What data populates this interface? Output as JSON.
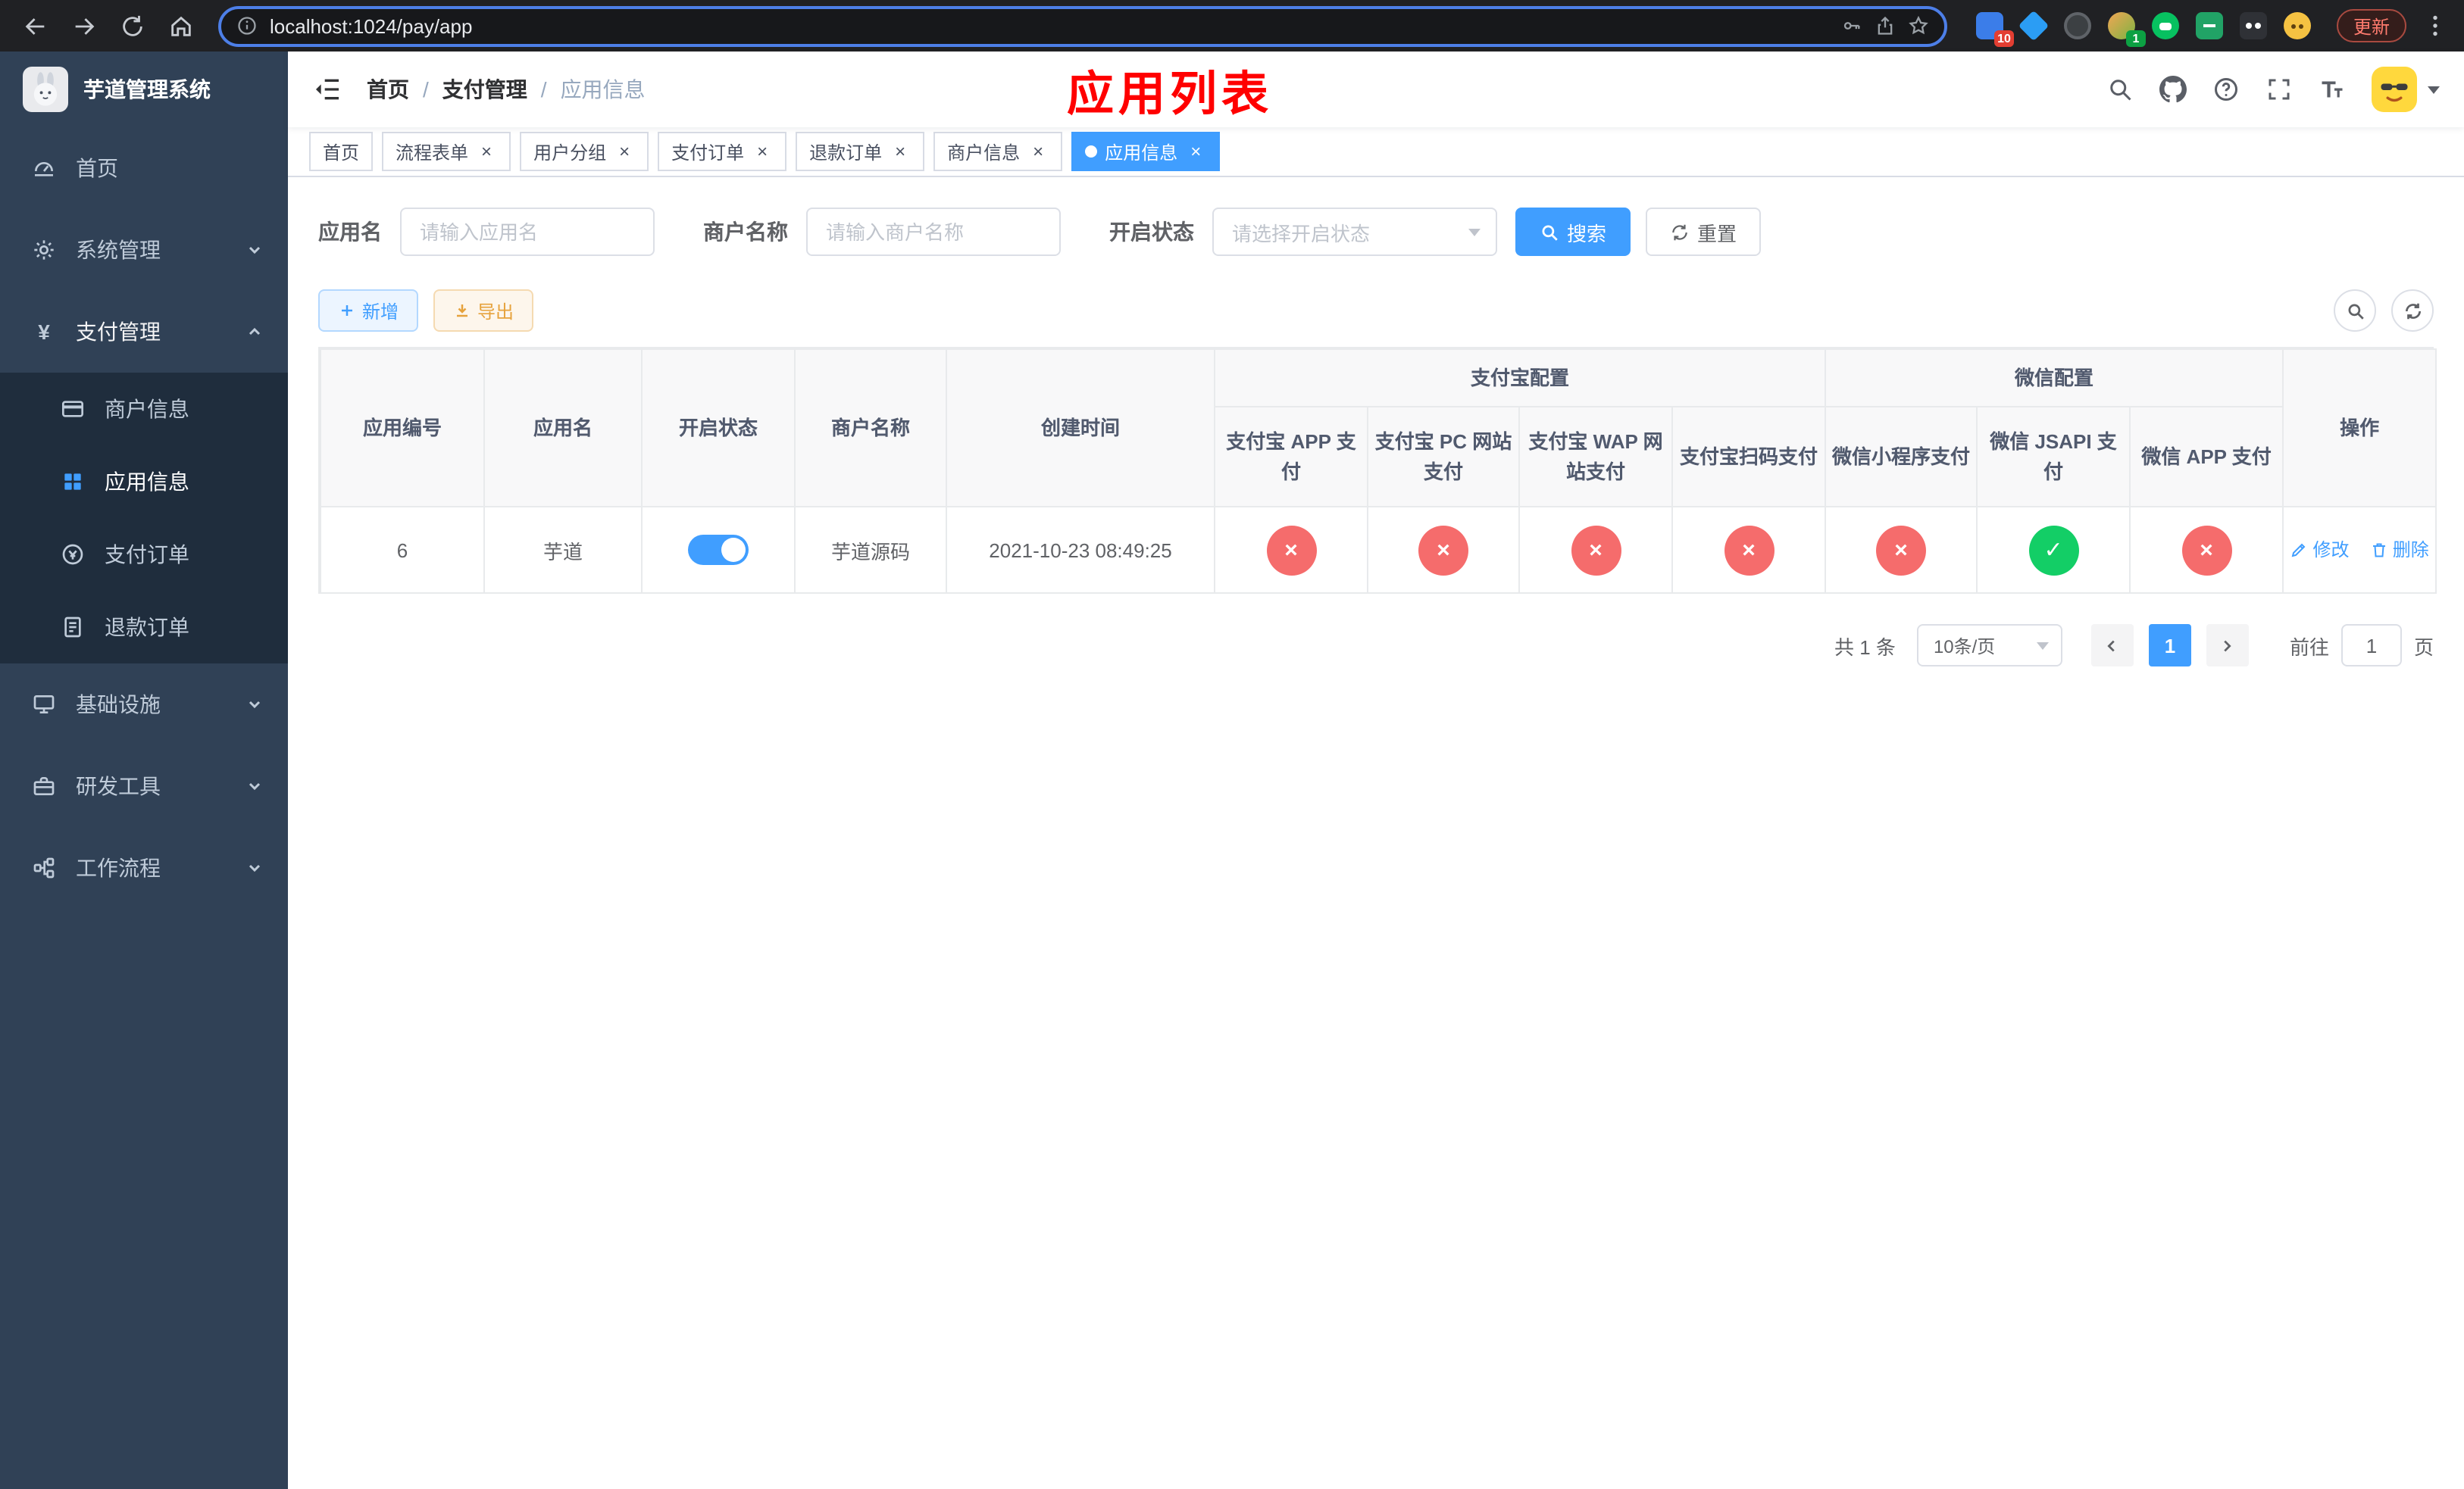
{
  "browser": {
    "url": "localhost:1024/pay/app",
    "update_label": "更新",
    "extension_badges": {
      "first": "10",
      "fourth": "1"
    }
  },
  "sidebar": {
    "app_title": "芋道管理系统",
    "menu": [
      {
        "label": "首页"
      },
      {
        "label": "系统管理"
      },
      {
        "label": "支付管理"
      },
      {
        "label": "基础设施"
      },
      {
        "label": "研发工具"
      },
      {
        "label": "工作流程"
      }
    ],
    "submenu": [
      {
        "label": "商户信息"
      },
      {
        "label": "应用信息"
      },
      {
        "label": "支付订单"
      },
      {
        "label": "退款订单"
      }
    ]
  },
  "header": {
    "breadcrumb": [
      "首页",
      "支付管理",
      "应用信息"
    ],
    "annotation": "应用列表"
  },
  "tabs": [
    {
      "label": "首页"
    },
    {
      "label": "流程表单"
    },
    {
      "label": "用户分组"
    },
    {
      "label": "支付订单"
    },
    {
      "label": "退款订单"
    },
    {
      "label": "商户信息"
    },
    {
      "label": "应用信息"
    }
  ],
  "glyphs": {
    "close": "×",
    "check": "✓",
    "cross": "×",
    "separator": "/"
  },
  "filters": {
    "app_name": {
      "label": "应用名",
      "placeholder": "请输入应用名"
    },
    "merchant": {
      "label": "商户名称",
      "placeholder": "请输入商户名称"
    },
    "status": {
      "label": "开启状态",
      "placeholder": "请选择开启状态"
    },
    "search_label": "搜索",
    "reset_label": "重置"
  },
  "toolbar": {
    "add_label": "新增",
    "export_label": "导出"
  },
  "table": {
    "columns": {
      "app_id": "应用编号",
      "app_name": "应用名",
      "status": "开启状态",
      "merchant_name": "商户名称",
      "create_time": "创建时间",
      "alipay_group": "支付宝配置",
      "wechat_group": "微信配置",
      "alipay_app": "支付宝 APP 支付",
      "alipay_pc": "支付宝 PC 网站支付",
      "alipay_wap": "支付宝 WAP 网站支付",
      "alipay_qr": "支付宝扫码支付",
      "wx_mini": "微信小程序支付",
      "wx_jsapi": "微信 JSAPI 支付",
      "wx_app": "微信 APP 支付",
      "actions": "操作"
    },
    "rows": [
      {
        "app_id": "6",
        "app_name": "芋道",
        "enabled": true,
        "merchant_name": "芋道源码",
        "create_time": "2021-10-23 08:49:25",
        "alipay_app": false,
        "alipay_pc": false,
        "alipay_wap": false,
        "alipay_qr": false,
        "wx_mini": false,
        "wx_jsapi": true,
        "wx_app": false,
        "edit_label": "修改",
        "delete_label": "删除"
      }
    ]
  },
  "pagination": {
    "total": "共 1 条",
    "page_size": "10条/页",
    "current_page": "1",
    "goto_label": "前往",
    "goto_value": "1",
    "goto_suffix": "页"
  },
  "colors": {
    "primary": "#409eff",
    "danger": "#f56c6c",
    "success": "#13ce66",
    "annotation": "#ff0000",
    "sidebar_bg": "#304156",
    "submenu_bg": "#1f2d3d"
  }
}
